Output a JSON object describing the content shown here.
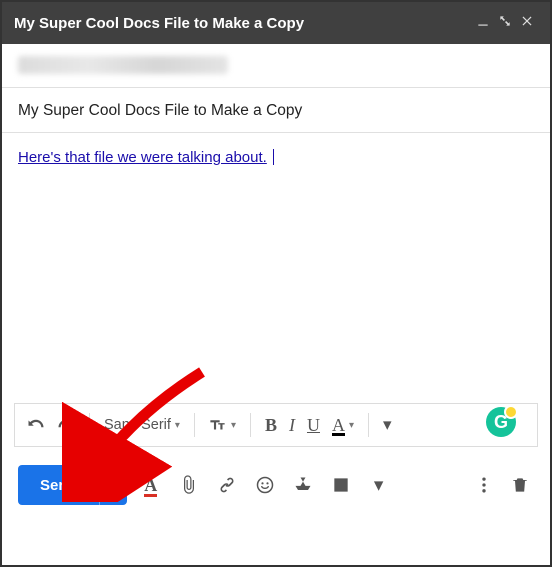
{
  "header": {
    "title": "My Super Cool Docs File to Make a Copy"
  },
  "compose": {
    "subject": "My Super Cool Docs File to Make a Copy",
    "body_link_text": "Here's that file we were talking about."
  },
  "toolbar": {
    "font_family": "Sans Serif"
  },
  "actions": {
    "send_label": "Send"
  }
}
